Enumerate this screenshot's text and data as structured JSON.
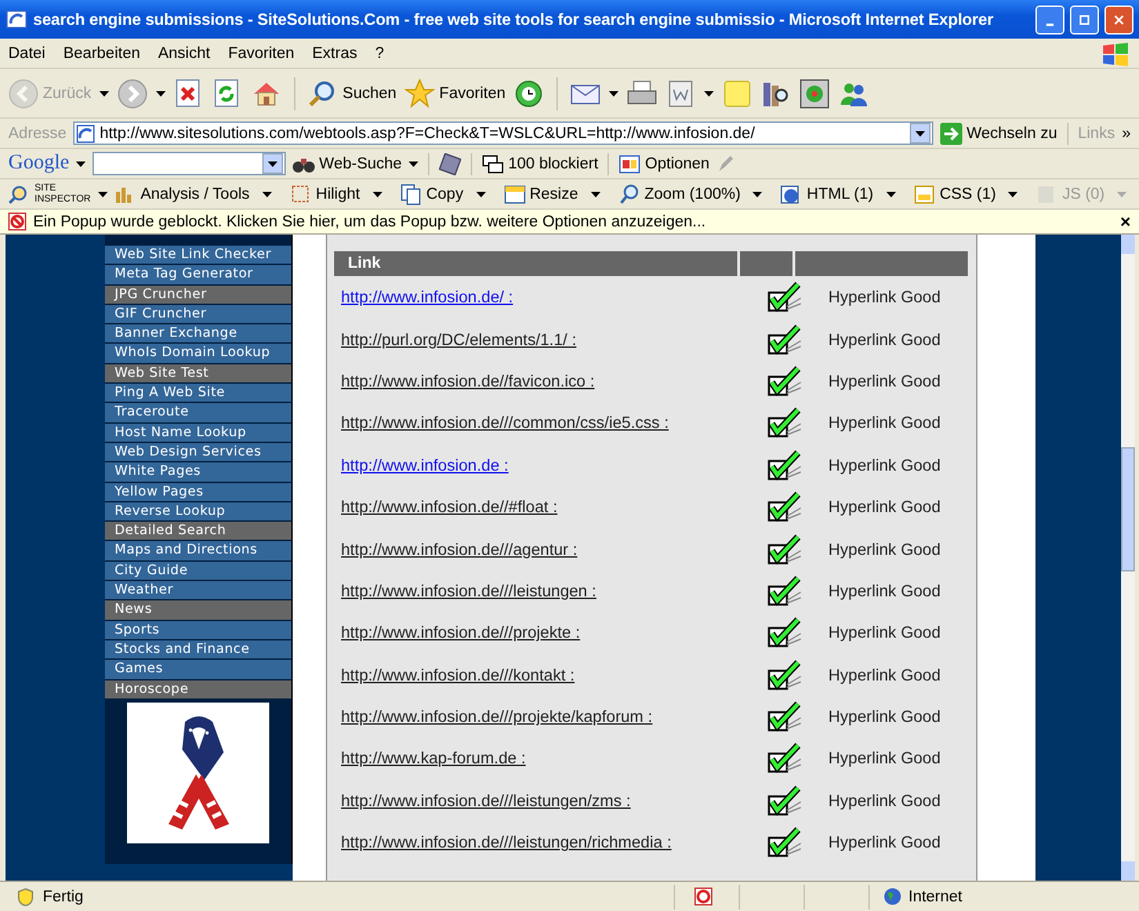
{
  "window": {
    "title": "search engine submissions - SiteSolutions.Com - free web site tools for search engine submissio - Microsoft Internet Explorer"
  },
  "menu": [
    "Datei",
    "Bearbeiten",
    "Ansicht",
    "Favoriten",
    "Extras",
    "?"
  ],
  "toolbar": {
    "back": {
      "label": "Zurück",
      "disabled": true
    },
    "search": "Suchen",
    "favorites": "Favoriten"
  },
  "address": {
    "label": "Adresse",
    "value": "http://www.sitesolutions.com/webtools.asp?F=Check&T=WSLC&URL=http://www.infosion.de/",
    "go": "Wechseln zu",
    "links": "Links",
    "more": "»"
  },
  "google_bar": {
    "logo": "Google",
    "search_button": "Web-Suche",
    "blocked": "100 blockiert",
    "options": "Optionen"
  },
  "inspector_bar": {
    "logo_top": "SITE",
    "logo_bottom": "INSPECTOR",
    "items": [
      {
        "label": "Analysis / Tools",
        "disabled": false
      },
      {
        "label": "Hilight",
        "disabled": false
      },
      {
        "label": "Copy",
        "disabled": false
      },
      {
        "label": "Resize",
        "disabled": false
      },
      {
        "label": "Zoom (100%)",
        "disabled": false
      },
      {
        "label": "HTML (1)",
        "disabled": false
      },
      {
        "label": "CSS (1)",
        "disabled": false
      },
      {
        "label": "JS (0)",
        "disabled": true
      }
    ]
  },
  "popup_bar": {
    "text": "Ein Popup wurde geblockt. Klicken Sie hier, um das Popup bzw. weitere Optionen anzuzeigen...",
    "close": "×"
  },
  "sidebar": {
    "items": [
      {
        "label": "Web Site Link Checker",
        "kind": "link"
      },
      {
        "label": "Meta Tag Generator",
        "kind": "link"
      },
      {
        "label": "JPG Cruncher",
        "kind": "header"
      },
      {
        "label": "GIF Cruncher",
        "kind": "link"
      },
      {
        "label": "Banner Exchange",
        "kind": "link"
      },
      {
        "label": "WhoIs Domain Lookup",
        "kind": "link"
      },
      {
        "label": "Web Site Test",
        "kind": "header"
      },
      {
        "label": "Ping A Web Site",
        "kind": "link"
      },
      {
        "label": "Traceroute",
        "kind": "link"
      },
      {
        "label": "Host Name Lookup",
        "kind": "link"
      },
      {
        "label": "Web Design Services",
        "kind": "link"
      },
      {
        "label": "White Pages",
        "kind": "link"
      },
      {
        "label": "Yellow Pages",
        "kind": "link"
      },
      {
        "label": "Reverse Lookup",
        "kind": "link"
      },
      {
        "label": "Detailed Search",
        "kind": "header"
      },
      {
        "label": "Maps and Directions",
        "kind": "link"
      },
      {
        "label": "City Guide",
        "kind": "link"
      },
      {
        "label": "Weather",
        "kind": "link"
      },
      {
        "label": "News",
        "kind": "header"
      },
      {
        "label": "Sports",
        "kind": "link"
      },
      {
        "label": "Stocks and Finance",
        "kind": "link"
      },
      {
        "label": "Games",
        "kind": "link"
      },
      {
        "label": "Horoscope",
        "kind": "header"
      }
    ]
  },
  "table": {
    "columns": [
      "Link"
    ],
    "rows": [
      {
        "url": "http://www.infosion.de/ :",
        "visited": false,
        "checked": true,
        "status": "Hyperlink Good"
      },
      {
        "url": "http://purl.org/DC/elements/1.1/ :",
        "visited": true,
        "checked": true,
        "status": "Hyperlink Good"
      },
      {
        "url": "http://www.infosion.de//favicon.ico :",
        "visited": true,
        "checked": true,
        "status": "Hyperlink Good"
      },
      {
        "url": "http://www.infosion.de///common/css/ie5.css :",
        "visited": true,
        "checked": true,
        "status": "Hyperlink Good"
      },
      {
        "url": "http://www.infosion.de :",
        "visited": false,
        "checked": true,
        "status": "Hyperlink Good"
      },
      {
        "url": "http://www.infosion.de//#float :",
        "visited": true,
        "checked": true,
        "status": "Hyperlink Good"
      },
      {
        "url": "http://www.infosion.de///agentur :",
        "visited": true,
        "checked": true,
        "status": "Hyperlink Good"
      },
      {
        "url": "http://www.infosion.de///leistungen :",
        "visited": true,
        "checked": true,
        "status": "Hyperlink Good"
      },
      {
        "url": "http://www.infosion.de///projekte :",
        "visited": true,
        "checked": true,
        "status": "Hyperlink Good"
      },
      {
        "url": "http://www.infosion.de///kontakt :",
        "visited": true,
        "checked": true,
        "status": "Hyperlink Good"
      },
      {
        "url": "http://www.infosion.de///projekte/kapforum :",
        "visited": true,
        "checked": true,
        "status": "Hyperlink Good"
      },
      {
        "url": "http://www.kap-forum.de :",
        "visited": true,
        "checked": true,
        "status": "Hyperlink Good"
      },
      {
        "url": "http://www.infosion.de///leistungen/zms :",
        "visited": true,
        "checked": true,
        "status": "Hyperlink Good"
      },
      {
        "url": "http://www.infosion.de///leistungen/richmedia :",
        "visited": true,
        "checked": true,
        "status": "Hyperlink Good"
      }
    ]
  },
  "status_bar": {
    "text": "Fertig",
    "zone": "Internet"
  }
}
